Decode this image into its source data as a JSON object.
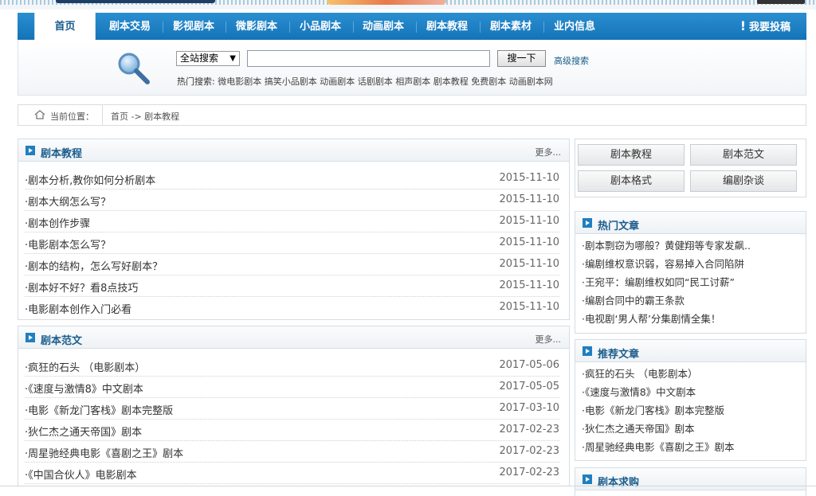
{
  "nav": {
    "items": [
      "首页",
      "剧本交易",
      "影视剧本",
      "微影剧本",
      "小品剧本",
      "动画剧本",
      "剧本教程",
      "剧本素材",
      "业内信息"
    ],
    "submit": "我要投稿",
    "accent": "#1a7cc1"
  },
  "search": {
    "scope": "全站搜索",
    "input_value": "",
    "button": "搜一下",
    "advanced": "高级搜索",
    "hot_label": "热门搜索:",
    "hot_terms": "微电影剧本 搞笑小品剧本 动画剧本 话剧剧本 相声剧本 剧本教程 免费剧本 动画剧本网"
  },
  "breadcrumb": {
    "label": "当前位置：",
    "path": "首页 -> 剧本教程"
  },
  "tutorials": {
    "title": "剧本教程",
    "more": "更多...",
    "rows": [
      {
        "title": "·剧本分析,教你如何分析剧本",
        "date": "2015-11-10"
      },
      {
        "title": "·剧本大纲怎么写？",
        "date": "2015-11-10"
      },
      {
        "title": "·剧本创作步骤",
        "date": "2015-11-10"
      },
      {
        "title": "·电影剧本怎么写？",
        "date": "2015-11-10"
      },
      {
        "title": "·剧本的结构，怎么写好剧本？",
        "date": "2015-11-10"
      },
      {
        "title": "·剧本好不好？看8点技巧",
        "date": "2015-11-10"
      },
      {
        "title": "·电影剧本创作入门必看",
        "date": "2015-11-10"
      }
    ]
  },
  "samples": {
    "title": "剧本范文",
    "more": "更多...",
    "rows": [
      {
        "title": "·疯狂的石头 （电影剧本）",
        "date": "2017-05-06"
      },
      {
        "title": "·《速度与激情8》中文剧本",
        "date": "2017-05-05"
      },
      {
        "title": "·电影《新龙门客栈》剧本完整版",
        "date": "2017-03-10"
      },
      {
        "title": "·狄仁杰之通天帝国》剧本",
        "date": "2017-02-23"
      },
      {
        "title": "·周星驰经典电影《喜剧之王》剧本",
        "date": "2017-02-23"
      },
      {
        "title": "·《中国合伙人》电影剧本",
        "date": "2017-02-23"
      }
    ]
  },
  "categories": [
    "剧本教程",
    "剧本范文",
    "剧本格式",
    "编剧杂谈"
  ],
  "hot_articles": {
    "title": "热门文章",
    "rows": [
      "·剧本剽窃为哪般？黄健翔等专家发飙..",
      "·编剧维权意识弱，容易掉入合同陷阱",
      "·王宛平：编剧维权如同“民工讨薪”",
      "·编剧合同中的霸王条款",
      "·电视剧‘男人帮’分集剧情全集！"
    ]
  },
  "recommended": {
    "title": "推荐文章",
    "rows": [
      "·疯狂的石头 （电影剧本）",
      "·《速度与激情8》中文剧本",
      "·电影《新龙门客栈》剧本完整版",
      "·狄仁杰之通天帝国》剧本",
      "·周星驰经典电影《喜剧之王》剧本"
    ]
  },
  "requests": {
    "title": "剧本求购"
  }
}
